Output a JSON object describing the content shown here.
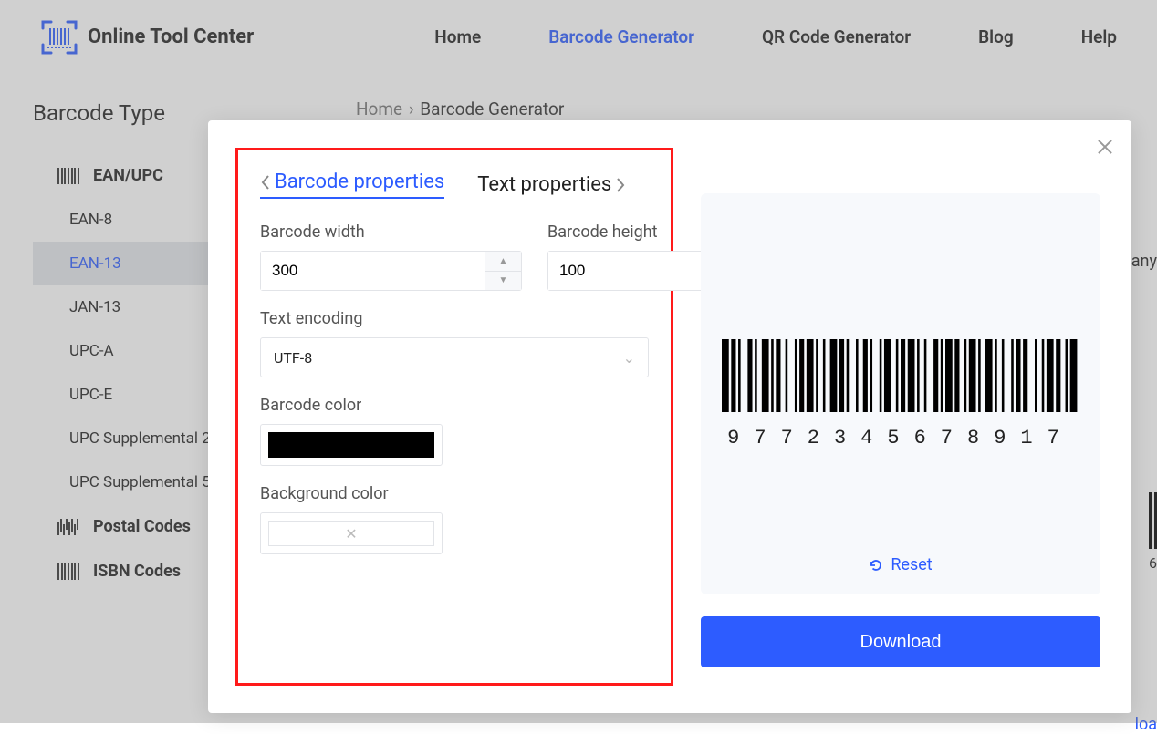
{
  "header": {
    "brand": "Online Tool Center",
    "nav": [
      "Home",
      "Barcode Generator",
      "QR Code Generator",
      "Blog",
      "Help"
    ],
    "active_nav_index": 1
  },
  "breadcrumbs": {
    "home": "Home",
    "current": "Barcode Generator"
  },
  "sidebar": {
    "title": "Barcode Type",
    "cats": [
      {
        "label": "EAN/UPC",
        "kind": "eanupc",
        "items": [
          "EAN-8",
          "EAN-13",
          "JAN-13",
          "UPC-A",
          "UPC-E",
          "UPC Supplemental 2",
          "UPC Supplemental 5"
        ],
        "active_index": 1
      },
      {
        "label": "Postal Codes",
        "kind": "postal",
        "items": []
      },
      {
        "label": "ISBN Codes",
        "kind": "isbn",
        "items": []
      }
    ]
  },
  "peek": {
    "right_text": "any",
    "digit": "6",
    "loa": "loa"
  },
  "modal": {
    "tabs": {
      "barcode_props": "Barcode properties",
      "text_props": "Text properties",
      "active": "barcode_props"
    },
    "fields": {
      "width_label": "Barcode width",
      "width_value": "300",
      "height_label": "Barcode height",
      "height_value": "100",
      "encoding_label": "Text encoding",
      "encoding_value": "UTF-8",
      "barcode_color_label": "Barcode color",
      "barcode_color": "#000000",
      "bg_color_label": "Background color",
      "bg_color": null
    },
    "preview": {
      "digits": "9772345678917",
      "reset_label": "Reset"
    },
    "download_label": "Download"
  }
}
